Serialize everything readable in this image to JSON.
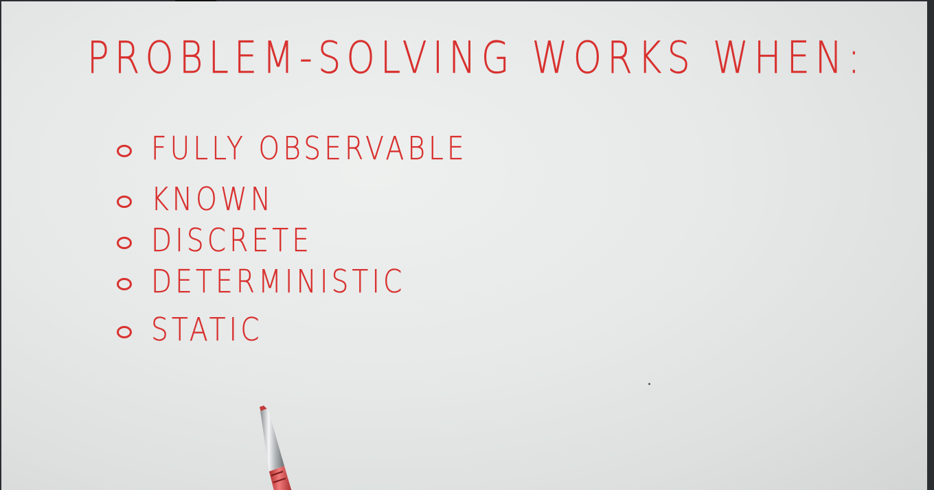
{
  "heading": "PROBLEM-SOLVING WORKS WHEN:",
  "conditions": [
    "FULLY OBSERVABLE",
    "KNOWN",
    "DISCRETE",
    "DETERMINISTIC",
    "STATIC"
  ],
  "colors": {
    "ink": "#d8312f",
    "paper": "#e6e9e8",
    "border": "#2b2e31"
  },
  "icons": {
    "bullet": "circle-bullet-icon",
    "pen": "pen-icon"
  }
}
